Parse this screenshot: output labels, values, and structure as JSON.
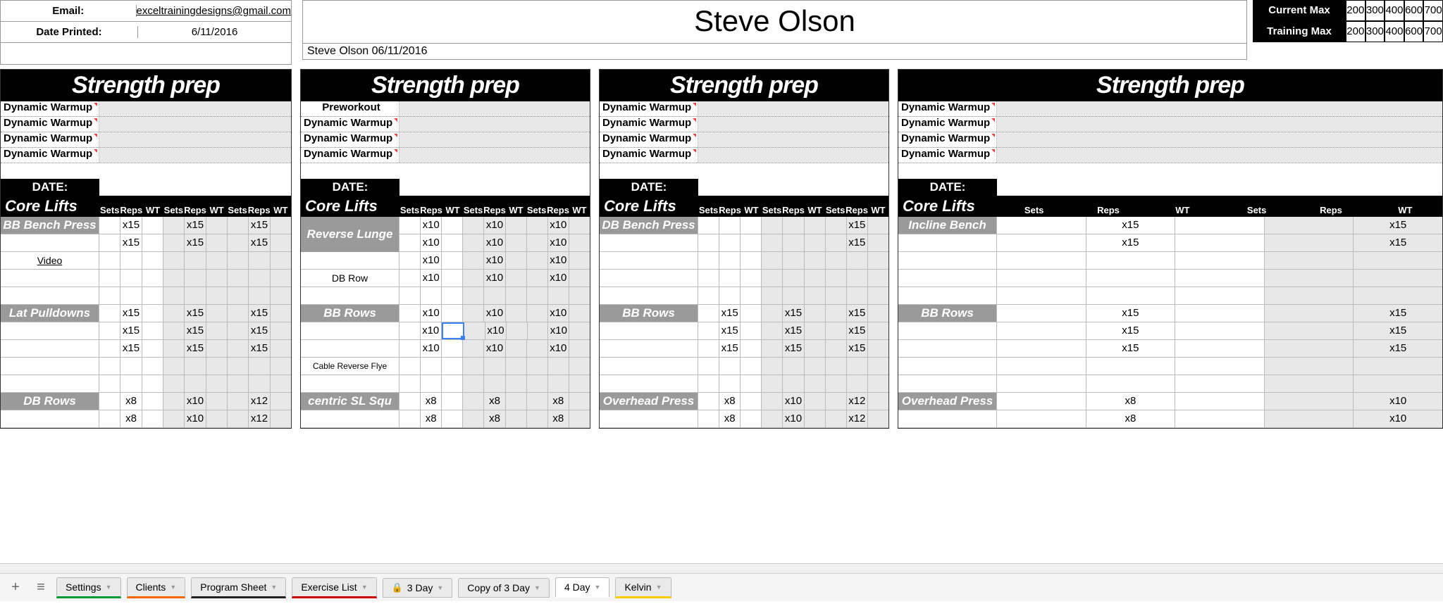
{
  "info": {
    "email_label": "Email:",
    "email": "exceltrainingdesigns@gmail.com",
    "date_label": "Date Printed:",
    "date": "6/11/2016"
  },
  "client_name": "Steve Olson",
  "name_sub": "Steve Olson 06/11/2016",
  "max": {
    "current_label": "Current Max",
    "training_label": "Training Max",
    "current": [
      "200",
      "300",
      "400",
      "600",
      "700"
    ],
    "training": [
      "200",
      "300",
      "400",
      "600",
      "700"
    ]
  },
  "sp_title": "Strength prep",
  "warmup": {
    "dynamic": "Dynamic Warmup",
    "preworkout": "Preworkout"
  },
  "date_hdr": "DATE:",
  "core_title": "Core Lifts",
  "srw": [
    "Sets",
    "Reps",
    "WT",
    "Sets",
    "Reps",
    "WT",
    "Sets",
    "Reps",
    "WT"
  ],
  "video": "Video",
  "day1": {
    "ex1": "BB Bench Press",
    "ex2": "Lat Pulldowns",
    "ex3": "DB Rows",
    "r1": [
      "",
      "x15",
      "",
      "",
      "x15",
      "",
      "",
      "x15",
      ""
    ],
    "r8": [
      "",
      "x8",
      "",
      "",
      "x10",
      "",
      "",
      "x12",
      ""
    ]
  },
  "day2": {
    "ex1": "Reverse Lunge",
    "ex1b": "DB Row",
    "ex2": "BB Rows",
    "ex2b": "Cable Reverse Flye",
    "ex3": "centric SL Squ",
    "r1": [
      "",
      "x10",
      "",
      "",
      "x10",
      "",
      "",
      "x10",
      ""
    ],
    "r8": [
      "",
      "x8",
      "",
      "",
      "x8",
      "",
      "",
      "x8",
      ""
    ]
  },
  "day3": {
    "ex1": "DB Bench Press",
    "ex2": "BB Rows",
    "ex3": "Overhead Press",
    "r1": [
      "",
      "",
      "",
      "",
      "",
      "",
      "",
      "x15",
      ""
    ],
    "r2": [
      "",
      "x15",
      "",
      "",
      "x15",
      "",
      "",
      "x15",
      ""
    ],
    "r8": [
      "",
      "x8",
      "",
      "",
      "x10",
      "",
      "",
      "x12",
      ""
    ]
  },
  "day4": {
    "ex1": "Incline Bench",
    "ex2": "BB Rows",
    "ex3": "Overhead Press",
    "r1": [
      "",
      "x15",
      "",
      "",
      "x15",
      ""
    ],
    "r2": [
      "",
      "x15",
      "",
      "",
      "x15",
      ""
    ],
    "r8": [
      "",
      "x8",
      "",
      "",
      "x10",
      ""
    ]
  },
  "tabs": {
    "settings": "Settings",
    "clients": "Clients",
    "program": "Program Sheet",
    "exercise": "Exercise List",
    "day3": "3 Day",
    "copy3": "Copy of 3 Day",
    "day4": "4 Day",
    "kelvin": "Kelvin"
  }
}
